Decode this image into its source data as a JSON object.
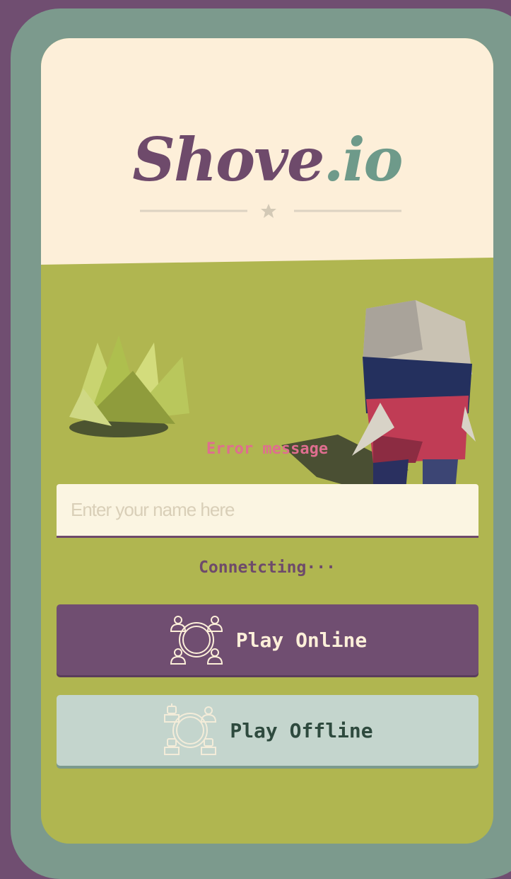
{
  "logo": {
    "main": "Shove",
    "suffix": ".io"
  },
  "error": {
    "text": "Error message"
  },
  "name_input": {
    "placeholder": "Enter your name here",
    "value": ""
  },
  "status": {
    "text": "Connetcting···"
  },
  "buttons": {
    "online": {
      "label": "Play Online",
      "icon": "multiplayer-people-icon"
    },
    "offline": {
      "label": "Play Offline",
      "icon": "robot-players-icon"
    }
  },
  "colors": {
    "background": "#704e71",
    "frame": "#7c9a8d",
    "sky": "#fdefd9",
    "ground": "#b0b650",
    "brand_purple": "#6e4a6b",
    "brand_teal": "#6e9a8a",
    "error": "#df6e8f",
    "offline_button": "#c4d5cd"
  }
}
